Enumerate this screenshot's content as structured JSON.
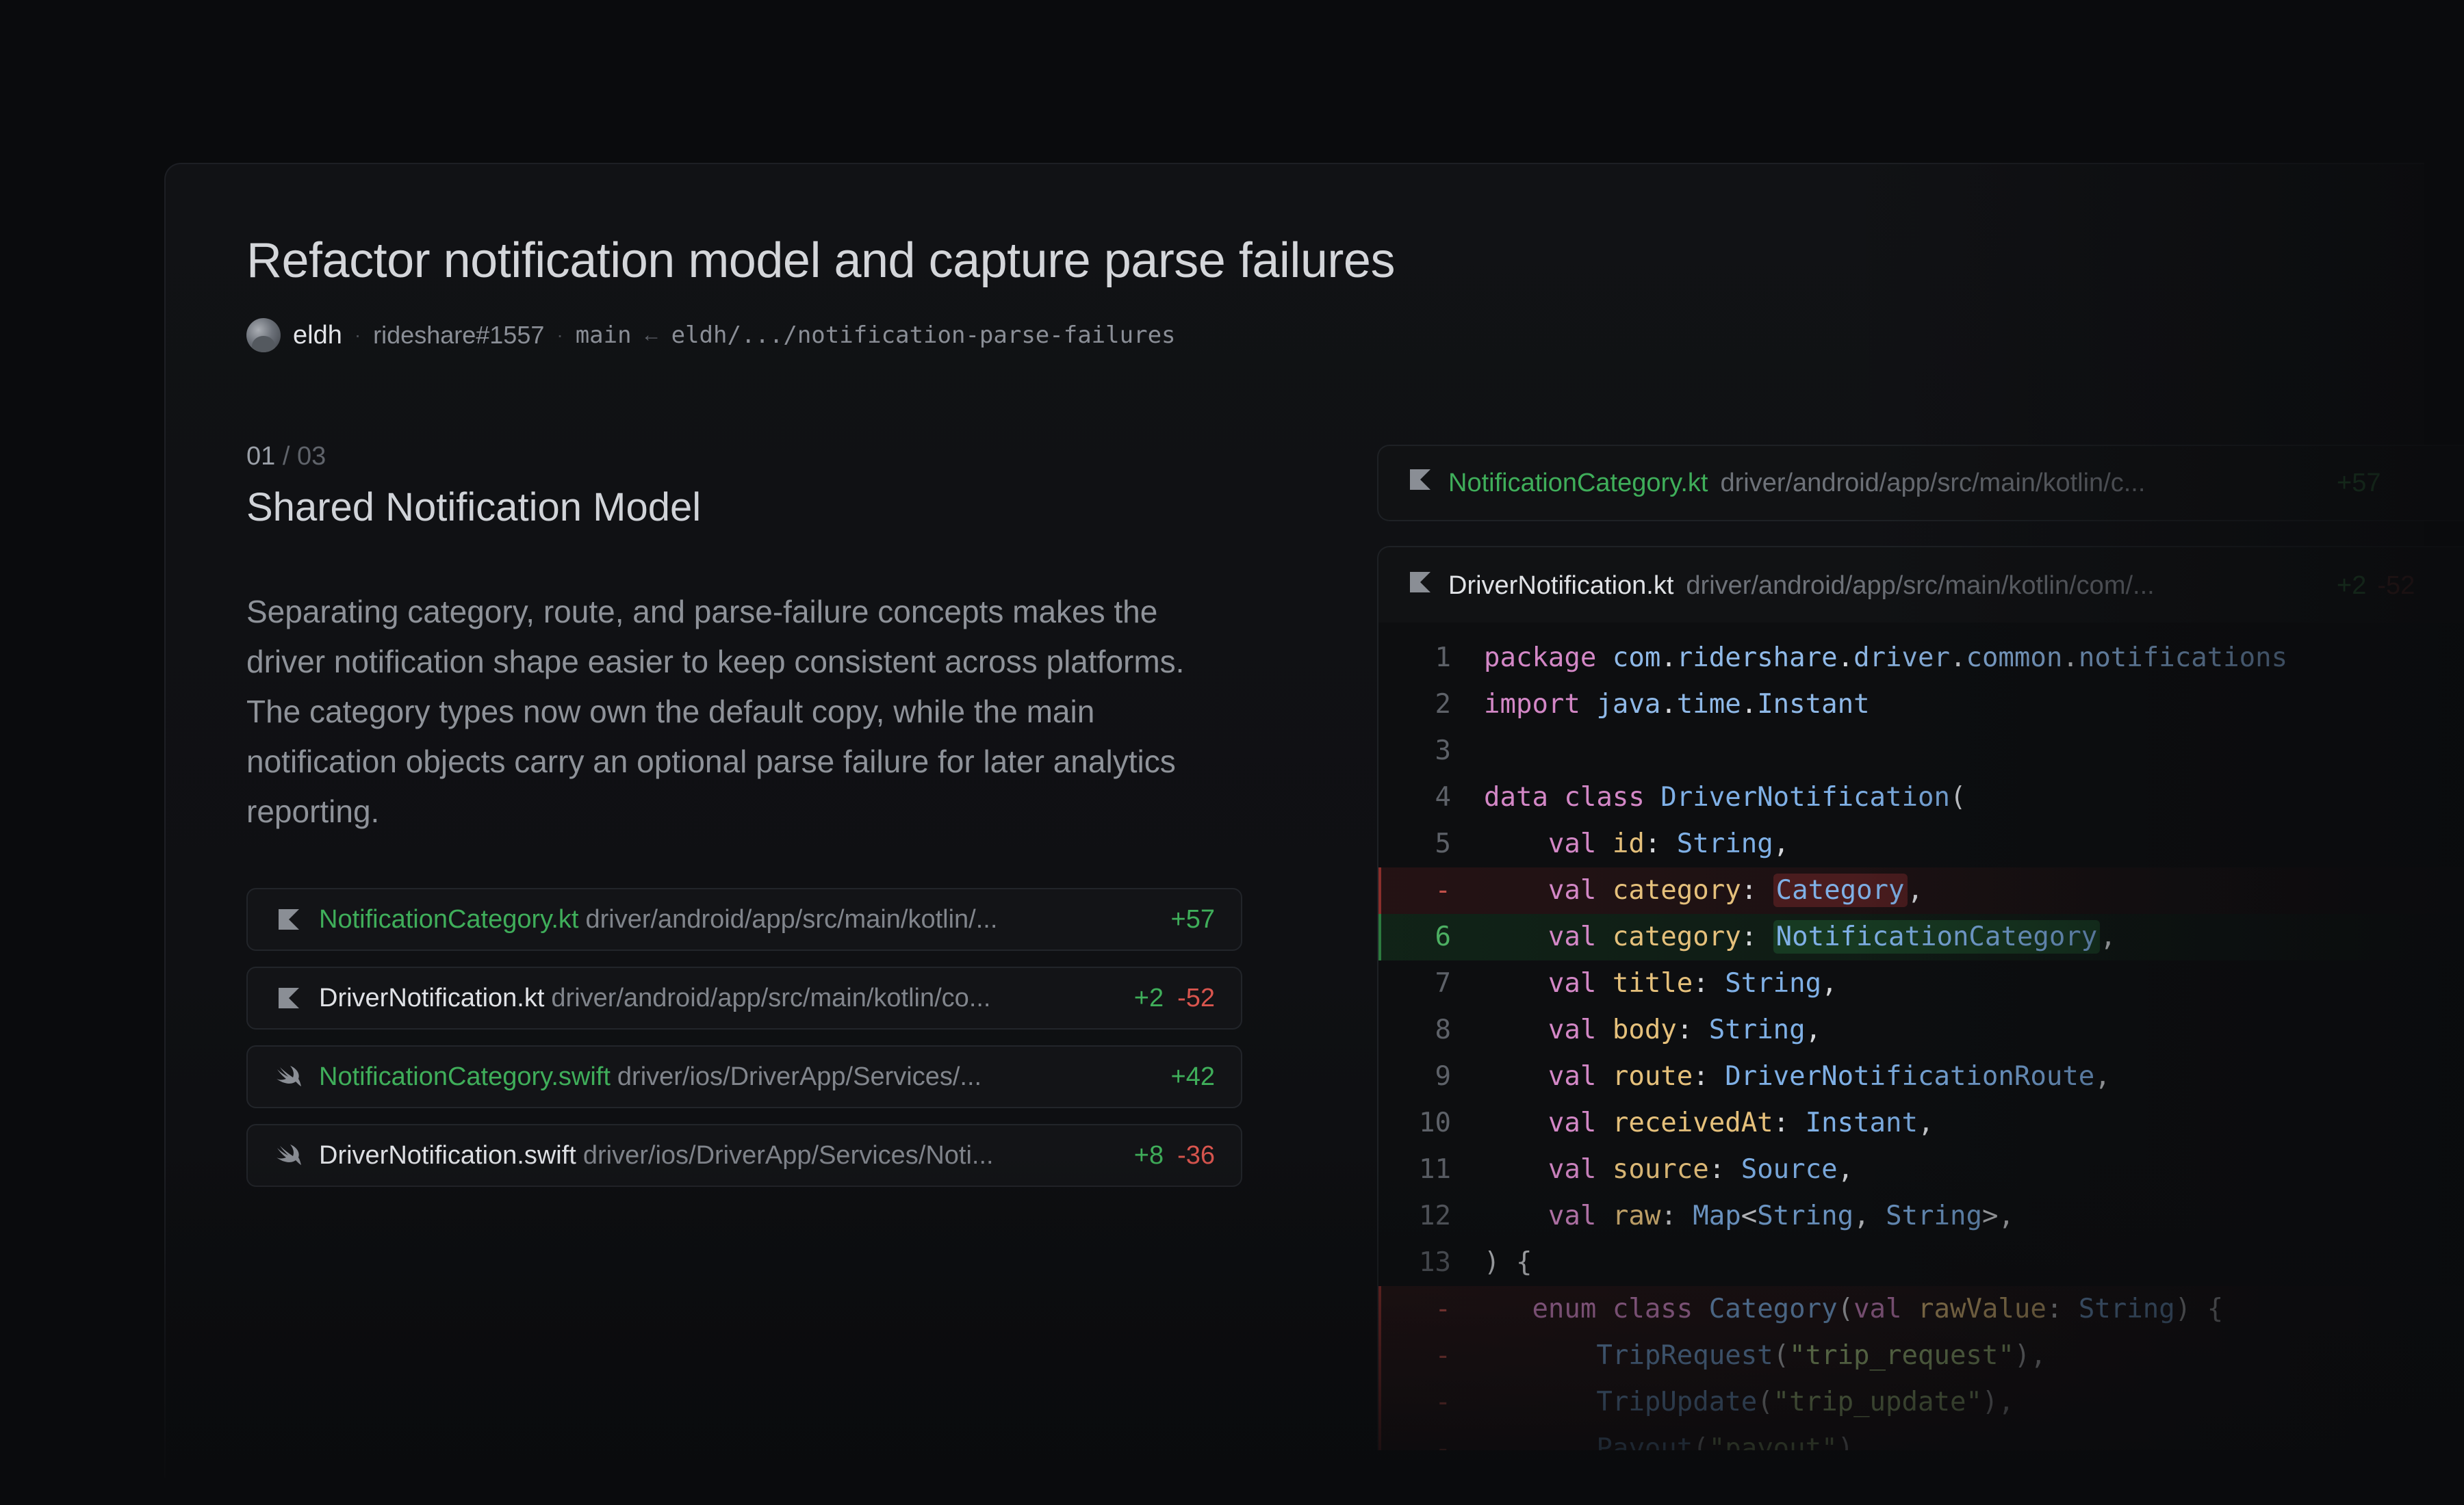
{
  "pr": {
    "title": "Refactor notification model and capture parse failures",
    "author": "eldh",
    "reference": "rideshare#1557",
    "base_branch": "main",
    "arrow": "←",
    "head_branch": "eldh/.../notification-parse-failures"
  },
  "section": {
    "index": "01",
    "separator": "/",
    "total": "03",
    "title": "Shared Notification Model",
    "description": "Separating category, route, and parse-failure concepts makes the driver notification shape easier to keep consistent across platforms. The category types now own the default copy, while the main notification objects carry an optional parse failure for later analytics reporting."
  },
  "files": [
    {
      "name": "NotificationCategory.kt",
      "path": "driver/android/app/src/main/kotlin/...",
      "additions": "+57",
      "deletions": "",
      "lang_icon": "kotlin-icon",
      "status": "new"
    },
    {
      "name": "DriverNotification.kt",
      "path": "driver/android/app/src/main/kotlin/co...",
      "additions": "+2",
      "deletions": "-52",
      "lang_icon": "kotlin-icon",
      "status": "modified"
    },
    {
      "name": "NotificationCategory.swift",
      "path": "driver/ios/DriverApp/Services/...",
      "additions": "+42",
      "deletions": "",
      "lang_icon": "swift-icon",
      "status": "new"
    },
    {
      "name": "DriverNotification.swift",
      "path": "driver/ios/DriverApp/Services/Noti...",
      "additions": "+8",
      "deletions": "-36",
      "lang_icon": "swift-icon",
      "status": "modified"
    }
  ],
  "diff_panels": [
    {
      "name": "NotificationCategory.kt",
      "path": "driver/android/app/src/main/kotlin/c...",
      "additions": "+57",
      "deletions": "",
      "status": "new"
    },
    {
      "name": "DriverNotification.kt",
      "path": "driver/android/app/src/main/kotlin/com/...",
      "additions": "+2",
      "deletions": "-52",
      "status": "modified"
    }
  ],
  "code_lines": [
    {
      "number": "1",
      "type": "context",
      "code": "package com.ridershare.driver.common.notifications"
    },
    {
      "number": "2",
      "type": "context",
      "code": "import java.time.Instant"
    },
    {
      "number": "3",
      "type": "context",
      "code": ""
    },
    {
      "number": "4",
      "type": "context",
      "code": "data class DriverNotification("
    },
    {
      "number": "5",
      "type": "context",
      "code": "    val id: String,"
    },
    {
      "number": "-",
      "type": "deleted",
      "code": "    val category: Category,"
    },
    {
      "number": "6",
      "type": "added",
      "code": "    val category: NotificationCategory,"
    },
    {
      "number": "7",
      "type": "context",
      "code": "    val title: String,"
    },
    {
      "number": "8",
      "type": "context",
      "code": "    val body: String,"
    },
    {
      "number": "9",
      "type": "context",
      "code": "    val route: DriverNotificationRoute,"
    },
    {
      "number": "10",
      "type": "context",
      "code": "    val receivedAt: Instant,"
    },
    {
      "number": "11",
      "type": "context",
      "code": "    val source: Source,"
    },
    {
      "number": "12",
      "type": "context",
      "code": "    val raw: Map<String, String>,"
    },
    {
      "number": "13",
      "type": "context",
      "code": ") {"
    },
    {
      "number": "-",
      "type": "deleted",
      "code": "   enum class Category(val rawValue: String) {"
    },
    {
      "number": "-",
      "type": "deleted",
      "code": "       TripRequest(\"trip_request\"),"
    },
    {
      "number": "-",
      "type": "deleted",
      "code": "       TripUpdate(\"trip_update\"),"
    },
    {
      "number": "-",
      "type": "deleted",
      "code": "       Payout(\"payout\"),"
    }
  ],
  "colors": {
    "background": "#0a0b0d",
    "added": "#3fae5a",
    "deleted": "#d9554e",
    "new_file": "#3fae5a"
  }
}
